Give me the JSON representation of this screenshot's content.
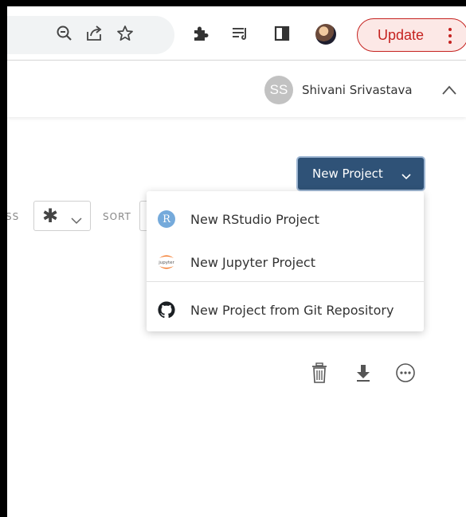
{
  "browser": {
    "toolbar_icons": [
      "zoom-out-icon",
      "share-icon",
      "bookmark-star-icon",
      "extensions-puzzle-icon",
      "reading-list-icon",
      "side-panel-icon"
    ],
    "update_label": "Update"
  },
  "header": {
    "user_initials": "SS",
    "user_name": "Shivani Srivastava"
  },
  "main": {
    "new_project_label": "New Project",
    "filters": {
      "access_label": "SS",
      "access_value": "✱",
      "sort_label": "SORT"
    },
    "dropdown": {
      "items": [
        {
          "icon": "r-icon",
          "icon_text": "R",
          "label": "New RStudio Project"
        },
        {
          "icon": "jupyter-icon",
          "icon_text": "jupyter",
          "label": "New Jupyter Project"
        },
        {
          "icon": "github-icon",
          "label": "New Project from Git Repository"
        }
      ]
    },
    "row_actions": [
      "trash-icon",
      "download-icon",
      "more-icon"
    ]
  },
  "colors": {
    "primary_button": "#2f5277",
    "update_border": "#c5221f",
    "update_bg": "#fce8e6",
    "r_badge": "#75aadb",
    "jupyter_orange": "#f37726"
  }
}
